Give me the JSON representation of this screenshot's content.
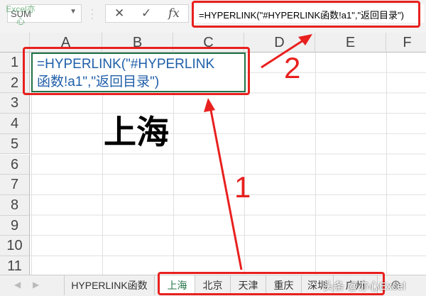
{
  "name_box": {
    "value": "SUM"
  },
  "formula_bar": {
    "cancel": "✕",
    "enter": "✓",
    "fx": "fx",
    "value": "=HYPERLINK(\"#HYPERLINK函数!a1\",\"返回目录\")"
  },
  "logo": {
    "text": "Excel亦心"
  },
  "columns": [
    "A",
    "B",
    "C",
    "D",
    "E",
    "F"
  ],
  "rows": [
    "1",
    "2",
    "3",
    "4",
    "5",
    "6",
    "7",
    "8",
    "9",
    "10",
    "11"
  ],
  "cell_a1": {
    "line1": "=HYPERLINK(\"#HYPERLINK",
    "line2": "函数!a1\",\"返回目录\")"
  },
  "cell_b5": {
    "value": "上海"
  },
  "sheet_tabs": [
    {
      "label": "HYPERLINK函数"
    },
    {
      "label": "上海",
      "active": true
    },
    {
      "label": "北京"
    },
    {
      "label": "天津"
    },
    {
      "label": "重庆"
    },
    {
      "label": "深圳"
    },
    {
      "label": "广州"
    }
  ],
  "annotations": {
    "n1": "1",
    "n2": "2"
  },
  "watermark": "头条 @亦心Excel"
}
